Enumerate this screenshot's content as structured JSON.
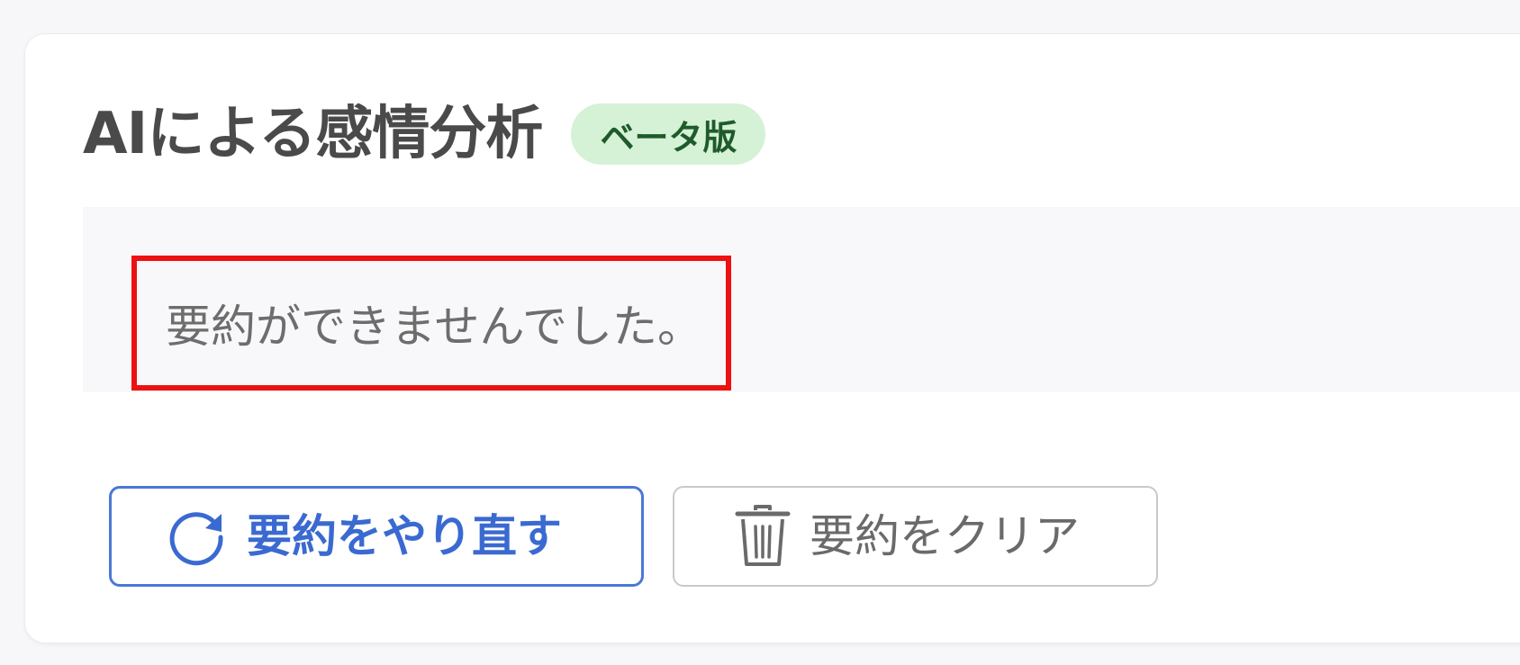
{
  "card": {
    "title": "AIによる感情分析",
    "badge": "ベータ版"
  },
  "result": {
    "message": "要約ができませんでした。"
  },
  "actions": {
    "retry_label": "要約をやり直す",
    "retry_icon": "refresh-icon",
    "clear_label": "要約をクリア",
    "clear_icon": "trash-icon"
  },
  "colors": {
    "primary": "#3a6ad1",
    "badge_bg": "#d5f2d6",
    "badge_text": "#1f5b2a",
    "highlight": "#ee1111"
  }
}
